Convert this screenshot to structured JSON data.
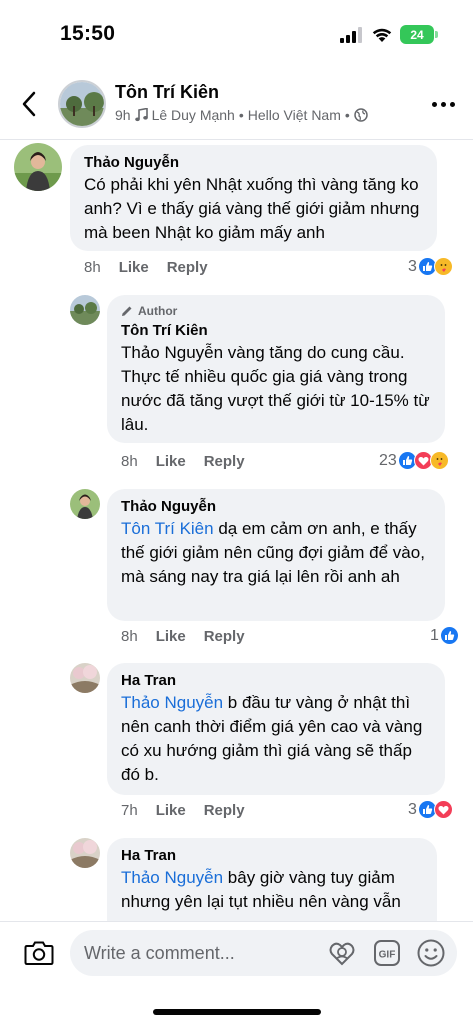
{
  "status_bar": {
    "time": "15:50",
    "battery": "24"
  },
  "header": {
    "name": "Tôn Trí Kiên",
    "time_ago": "9h",
    "music": "Lê Duy Mạnh",
    "separator": "•",
    "song": "Hello Việt Nam",
    "separator2": "•"
  },
  "comments": [
    {
      "author": "Thảo Nguyễn",
      "text": "Có phải khi yên Nhật xuống thì vàng tăng ko anh? Vì e thấy giá vàng thế giới giảm nhưng mà been Nhật ko giảm mấy anh",
      "time": "8h",
      "like": "Like",
      "reply": "Reply",
      "reactions": "3",
      "reaction_icons": [
        "like",
        "care"
      ]
    },
    {
      "badge": "Author",
      "author": "Tôn Trí Kiên",
      "text": "Thảo Nguyễn vàng tăng do cung cầu. Thực tế nhiều quốc gia giá vàng trong nước đã tăng vượt thế giới từ 10-15% từ lâu.",
      "time": "8h",
      "like": "Like",
      "reply": "Reply",
      "reactions": "23",
      "reaction_icons": [
        "like",
        "love",
        "care"
      ]
    },
    {
      "author": "Thảo Nguyễn",
      "mention": "Tôn Trí Kiên",
      "text": " dạ em cảm ơn anh, e thấy thế giới giảm nên cũng đợi giảm để vào, mà sáng nay tra giá lại lên rồi anh ah",
      "time": "8h",
      "like": "Like",
      "reply": "Reply",
      "reactions": "1",
      "reaction_icons": [
        "like"
      ]
    },
    {
      "author": "Ha Tran",
      "mention": "Thảo Nguyễn",
      "text": " b đầu tư vàng ở nhật thì nên canh thời điểm giá yên cao và vàng có xu hướng giảm thì giá vàng sẽ thấp đó b.",
      "time": "7h",
      "like": "Like",
      "reply": "Reply",
      "reactions": "3",
      "reaction_icons": [
        "like",
        "love"
      ]
    },
    {
      "author": "Ha Tran",
      "mention": "Thảo Nguyễn",
      "text": " bây giờ vàng tuy giảm nhưng yên lại tụt nhiều nên vàng vẫn"
    }
  ],
  "composer": {
    "placeholder": "Write a comment..."
  },
  "colors": {
    "accent": "#1877f2",
    "mention": "#1a6ed8",
    "bubble": "#f0f2f5",
    "muted": "#65676b"
  }
}
